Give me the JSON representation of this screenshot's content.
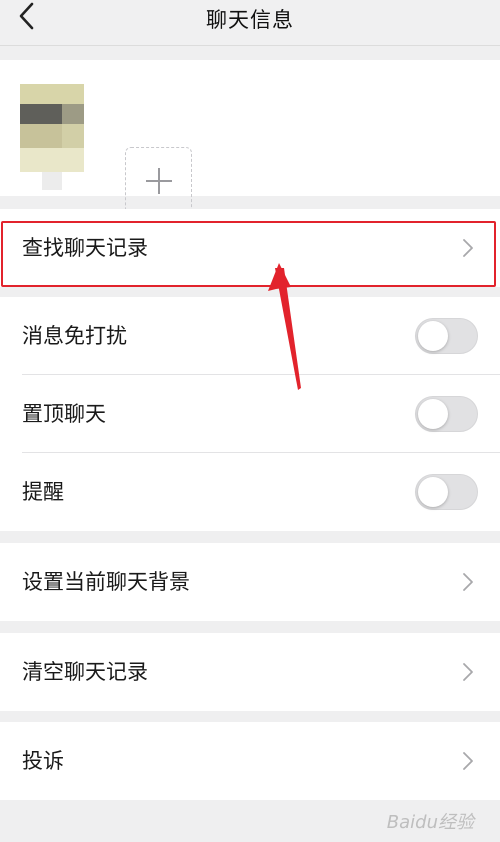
{
  "header": {
    "title": "聊天信息"
  },
  "members": {
    "add_label": "+"
  },
  "cells": {
    "find_history": "查找聊天记录",
    "mute": "消息免打扰",
    "pin": "置顶聊天",
    "remind": "提醒",
    "set_background": "设置当前聊天背景",
    "clear_history": "清空聊天记录",
    "report": "投诉"
  },
  "toggles": {
    "mute_on": false,
    "pin_on": false,
    "remind_on": false
  },
  "watermark": "Baidu经验",
  "colors": {
    "annotation_red": "#e2232c",
    "background": "#efeff0"
  }
}
